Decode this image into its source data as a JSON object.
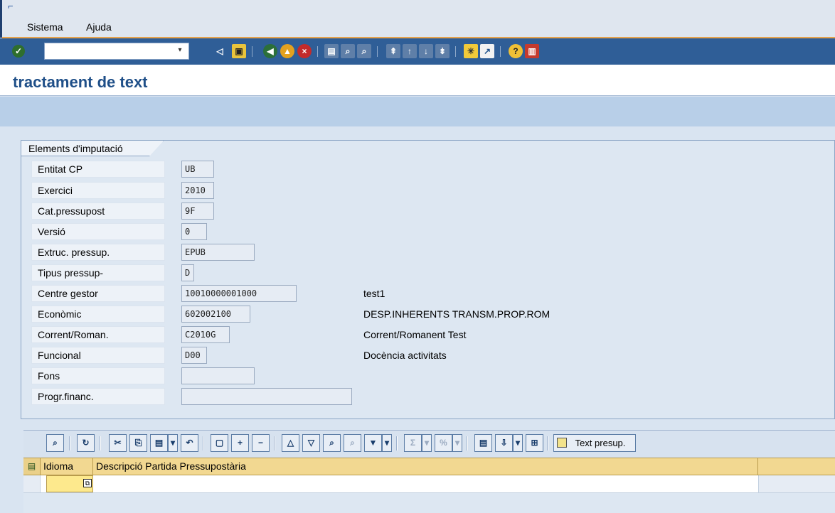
{
  "menu": {
    "items": [
      {
        "label": "Sistema"
      },
      {
        "label": "Ajuda"
      }
    ]
  },
  "toolbar": {
    "command_value": "",
    "icons": [
      "enter-icon",
      "back-icon",
      "save-icon",
      "back-nav-icon",
      "exit-icon",
      "cancel-icon",
      "print-icon",
      "find-icon",
      "find-next-icon",
      "first-page-icon",
      "previous-page-icon",
      "next-page-icon",
      "last-page-icon",
      "create-session-icon",
      "shortcut-icon",
      "help-icon",
      "layout-menu-icon"
    ]
  },
  "page": {
    "title": "tractament de text"
  },
  "group": {
    "title": "Elements d'imputació",
    "rows": [
      {
        "label": "Entitat CP",
        "value": "UB",
        "description": ""
      },
      {
        "label": "Exercici",
        "value": "2010",
        "description": ""
      },
      {
        "label": "Cat.pressupost",
        "value": "9F",
        "description": ""
      },
      {
        "label": "Versió",
        "value": "0",
        "description": ""
      },
      {
        "label": "Extruc. pressup.",
        "value": "EPUB",
        "description": ""
      },
      {
        "label": "Tipus pressup-",
        "value": "D",
        "description": ""
      },
      {
        "label": "Centre gestor",
        "value": "10010000001000",
        "description": "test1"
      },
      {
        "label": "Econòmic",
        "value": "602002100",
        "description": "DESP.INHERENTS TRANSM.PROP.ROM"
      },
      {
        "label": "Corrent/Roman.",
        "value": "C2010G",
        "description": "Corrent/Romanent Test"
      },
      {
        "label": "Funcional",
        "value": "D00",
        "description": "Docència activitats"
      },
      {
        "label": "Fons",
        "value": "",
        "description": ""
      },
      {
        "label": "Progr.financ.",
        "value": "",
        "description": ""
      }
    ]
  },
  "table": {
    "button_text_presup": "Text presup.",
    "columns": [
      "Idioma",
      "Descripció Partida Pressupostària"
    ],
    "row": {
      "idioma": "",
      "descripcio": ""
    }
  },
  "colors": {
    "toolbar": "#2f5e97",
    "title": "#1f4f88",
    "header": "#f2d891"
  }
}
